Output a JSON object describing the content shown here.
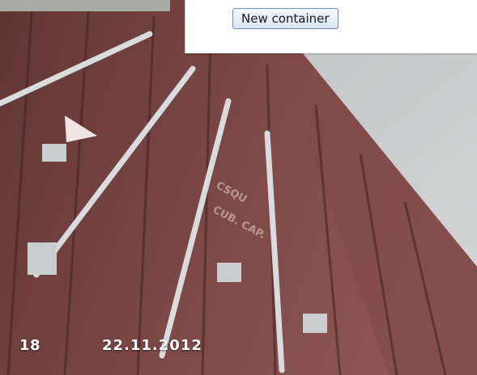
{
  "panel": {
    "new_container_label": "New container"
  },
  "footer": {
    "slide_number": "18",
    "date": "22.11.2012"
  },
  "colors": {
    "panel_background": "#ffffff",
    "button_border": "#6e8fb2",
    "footer_text": "#ffffff"
  }
}
